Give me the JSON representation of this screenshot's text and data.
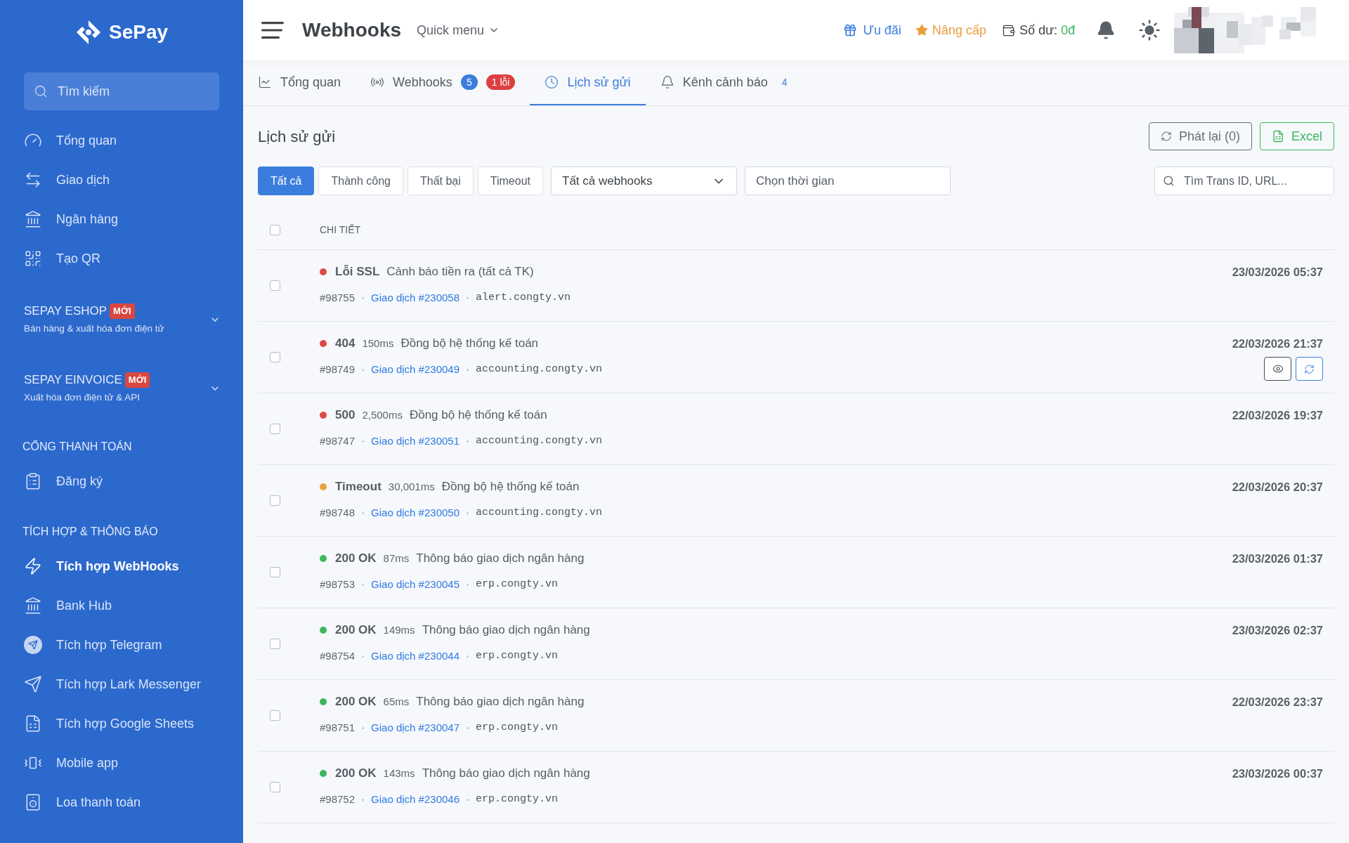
{
  "sidebar": {
    "logo": "SePay",
    "search": {
      "placeholder": "Tìm kiếm"
    },
    "items": [
      {
        "kind": "link",
        "label": "Tổng quan",
        "selected": false
      },
      {
        "kind": "link",
        "label": "Giao dịch",
        "selected": false
      },
      {
        "kind": "link",
        "label": "Ngân hàng",
        "selected": false
      },
      {
        "kind": "link",
        "label": "Tạo QR",
        "selected": false
      },
      {
        "kind": "product",
        "title": "SEPAY ESHOP",
        "badge": "MỚI",
        "subtitle": "Bán hàng & xuất hóa đơn điện tử",
        "expanded": false
      },
      {
        "kind": "product",
        "title": "SEPAY EINVOICE",
        "badge": "MỚI",
        "subtitle": "Xuất hóa đơn điện tử & API",
        "expanded": false
      },
      {
        "kind": "heading",
        "label": "CỔNG THANH TOÁN"
      },
      {
        "kind": "link",
        "label": "Đăng ký",
        "selected": false
      },
      {
        "kind": "heading",
        "label": "TÍCH HỢP & THÔNG BÁO"
      },
      {
        "kind": "link",
        "label": "Tích hợp WebHooks",
        "selected": true
      },
      {
        "kind": "link",
        "label": "Bank Hub",
        "selected": false
      },
      {
        "kind": "link",
        "label": "Tích hợp Telegram",
        "selected": false
      },
      {
        "kind": "link",
        "label": "Tích hợp Lark Messenger",
        "selected": false
      },
      {
        "kind": "link",
        "label": "Tích hợp Google Sheets",
        "selected": false
      },
      {
        "kind": "link",
        "label": "Mobile app",
        "selected": false
      },
      {
        "kind": "link",
        "label": "Loa thanh toán",
        "selected": false
      }
    ]
  },
  "header": {
    "title": "Webhooks",
    "quick_menu": "Quick menu",
    "offer": "Ưu đãi",
    "upgrade": "Nâng cấp",
    "balance": {
      "label": "Số dư:",
      "value": "0đ"
    }
  },
  "tabs": [
    {
      "label": "Tổng quan",
      "selected": false
    },
    {
      "label": "Webhooks",
      "selected": false,
      "badges": [
        {
          "kind": "count",
          "text": "5"
        },
        {
          "kind": "error",
          "text": "1 lỗi"
        }
      ]
    },
    {
      "label": "Lịch sử gửi",
      "selected": true
    },
    {
      "label": "Kênh cảnh báo",
      "selected": false,
      "badges": [
        {
          "kind": "plain",
          "text": "4"
        }
      ]
    }
  ],
  "page": {
    "title": "Lịch sử gửi",
    "actions": [
      {
        "kind": "replay",
        "label": "Phát lại (0)"
      },
      {
        "kind": "excel",
        "label": "Excel"
      }
    ],
    "filters": [
      {
        "label": "Tất cả",
        "selected": true
      },
      {
        "label": "Thành công",
        "selected": false
      },
      {
        "label": "Thất bại",
        "selected": false
      },
      {
        "label": "Timeout",
        "selected": false
      }
    ],
    "webhook_select": {
      "value": "Tất cả webhooks"
    },
    "time_field": {
      "placeholder": "Chọn thời gian"
    },
    "search": {
      "placeholder": "Tìm Trans ID, URL..."
    }
  },
  "table": {
    "select_all": {
      "checked": false
    },
    "columns": [
      "CHI TIẾT"
    ],
    "rows": [
      {
        "checked": false,
        "color": "#dc4a48",
        "status": "Lỗi SSL",
        "name": "Cảnh báo tiền ra (tất cả TK)",
        "id": "#98755",
        "transaction": "Giao dịch #230058",
        "host": "alert.congty.vn",
        "time": "23/03/2026 05:37",
        "hovered": false
      },
      {
        "checked": false,
        "color": "#dc4a48",
        "status": "404",
        "duration": "150ms",
        "name": "Đồng bộ hệ thống kế toán",
        "id": "#98749",
        "transaction": "Giao dịch #230049",
        "host": "accounting.congty.vn",
        "time": "22/03/2026 21:37",
        "hovered": true
      },
      {
        "checked": false,
        "color": "#dc4a48",
        "status": "500",
        "duration": "2,500ms",
        "name": "Đồng bộ hệ thống kế toán",
        "id": "#98747",
        "transaction": "Giao dịch #230051",
        "host": "accounting.congty.vn",
        "time": "22/03/2026 19:37",
        "hovered": false
      },
      {
        "checked": false,
        "color": "#e9a33c",
        "status": "Timeout",
        "duration": "30,001ms",
        "name": "Đồng bộ hệ thống kế toán",
        "id": "#98748",
        "transaction": "Giao dịch #230050",
        "host": "accounting.congty.vn",
        "time": "22/03/2026 20:37",
        "hovered": false
      },
      {
        "checked": false,
        "color": "#3db560",
        "status": "200 OK",
        "duration": "87ms",
        "name": "Thông báo giao dịch ngân hàng",
        "id": "#98753",
        "transaction": "Giao dịch #230045",
        "host": "erp.congty.vn",
        "time": "23/03/2026 01:37",
        "hovered": false
      },
      {
        "checked": false,
        "color": "#3db560",
        "status": "200 OK",
        "duration": "149ms",
        "name": "Thông báo giao dịch ngân hàng",
        "id": "#98754",
        "transaction": "Giao dịch #230044",
        "host": "erp.congty.vn",
        "time": "23/03/2026 02:37",
        "hovered": false
      },
      {
        "checked": false,
        "color": "#3db560",
        "status": "200 OK",
        "duration": "65ms",
        "name": "Thông báo giao dịch ngân hàng",
        "id": "#98751",
        "transaction": "Giao dịch #230047",
        "host": "erp.congty.vn",
        "time": "22/03/2026 23:37",
        "hovered": false
      },
      {
        "checked": false,
        "color": "#3db560",
        "status": "200 OK",
        "duration": "143ms",
        "name": "Thông báo giao dịch ngân hàng",
        "id": "#98752",
        "transaction": "Giao dịch #230046",
        "host": "erp.congty.vn",
        "time": "23/03/2026 00:37",
        "hovered": false
      }
    ]
  }
}
